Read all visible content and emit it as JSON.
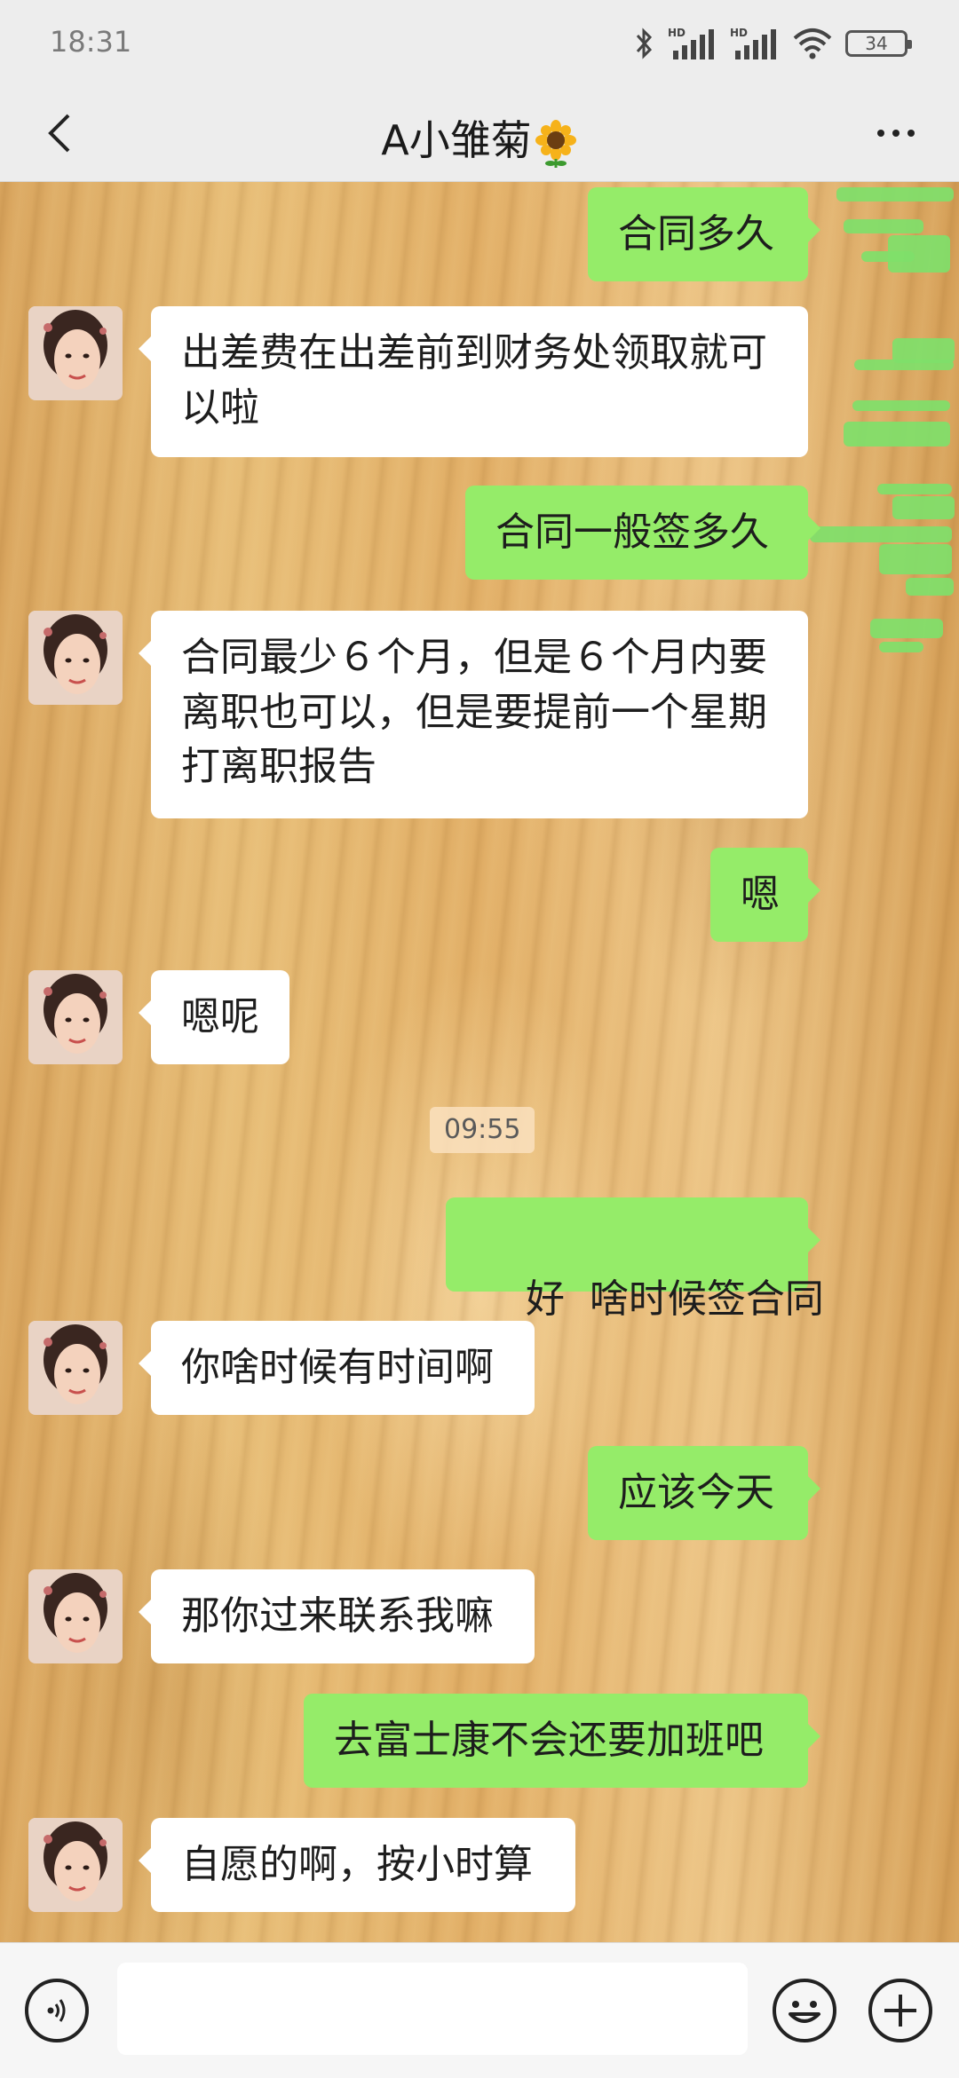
{
  "status_bar": {
    "time": "18:31",
    "battery": "34",
    "icons": [
      "bluetooth-icon",
      "hd-signal-icon",
      "hd-signal-icon",
      "wifi-icon",
      "battery-icon"
    ]
  },
  "header": {
    "title": "A小雏菊",
    "title_emoji": "sunflower-icon",
    "back_icon": "back-chevron-icon",
    "more_icon": "more-dots-icon"
  },
  "messages": [
    {
      "from": "me",
      "text": "合同多久"
    },
    {
      "from": "contact",
      "text": "出差费在出差前到财务处领取就可以啦"
    },
    {
      "from": "me",
      "text": "合同一般签多久"
    },
    {
      "from": "contact",
      "text": "合同最少６个月，但是６个月内要离职也可以，但是要提前一个星期打离职报告"
    },
    {
      "from": "me",
      "text": "嗯"
    },
    {
      "from": "contact",
      "text": "嗯呢"
    },
    {
      "from": "me",
      "text": "好  啥时候签合同"
    },
    {
      "from": "contact",
      "text": "你啥时候有时间啊"
    },
    {
      "from": "me",
      "text": "应该今天"
    },
    {
      "from": "contact",
      "text": "那你过来联系我嘛"
    },
    {
      "from": "me",
      "text": "去富士康不会还要加班吧"
    },
    {
      "from": "contact",
      "text": "自愿的啊，按小时算"
    }
  ],
  "timestamp": "09:55",
  "input_bar": {
    "placeholder": "",
    "voice_icon": "voice-icon",
    "emoji_icon": "emoji-icon",
    "plus_icon": "plus-icon"
  },
  "colors": {
    "outgoing_bubble": "#95ec69",
    "incoming_bubble": "#ffffff",
    "header_bg": "#ededed"
  }
}
